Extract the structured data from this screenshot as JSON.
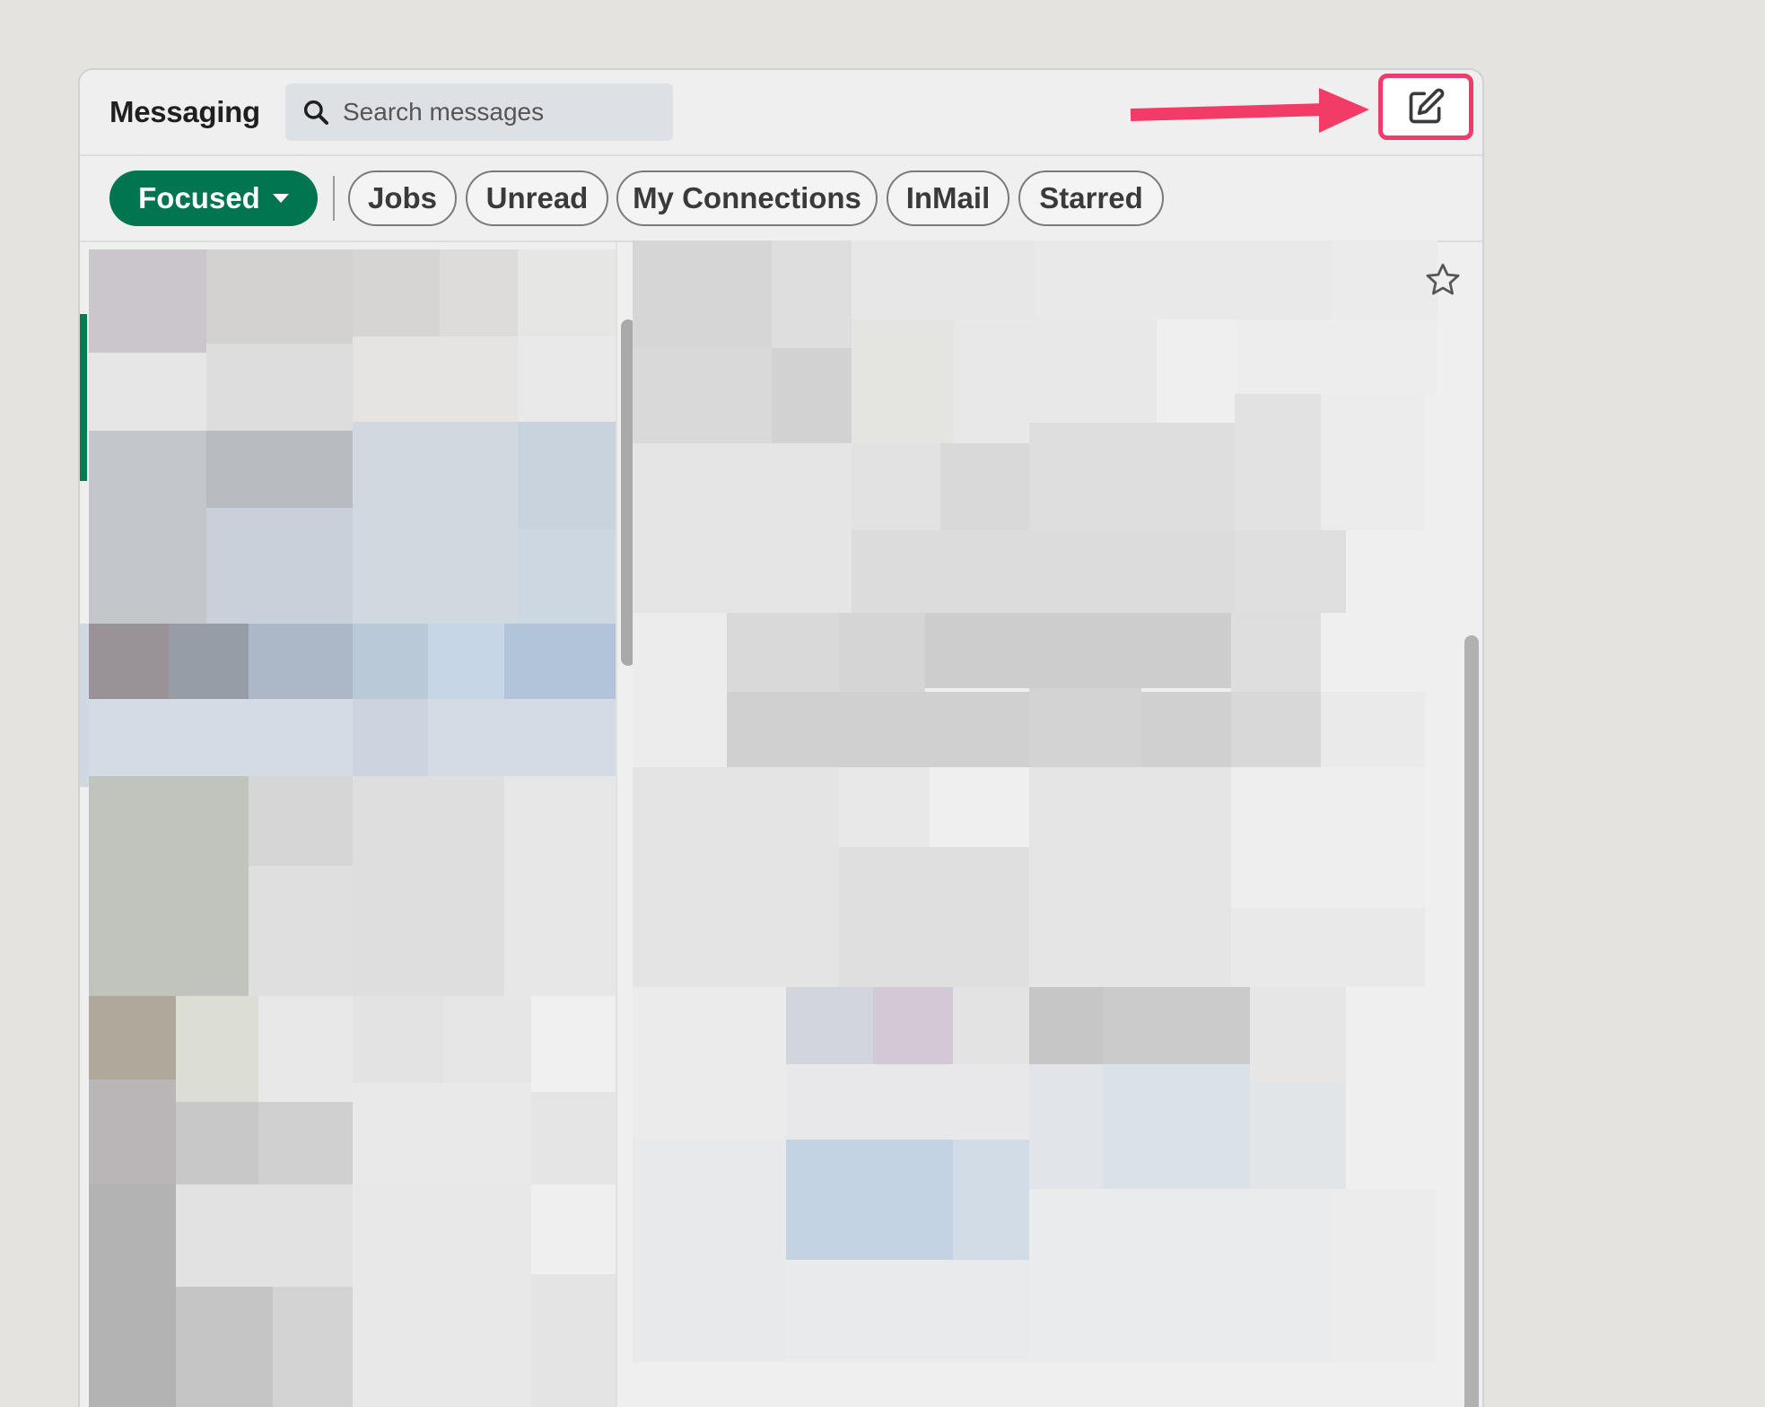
{
  "header": {
    "title": "Messaging",
    "search": {
      "placeholder": "Search messages",
      "icon": "search-icon"
    },
    "compose": {
      "icon": "compose-icon",
      "highlight_color": "#ef3c6a"
    }
  },
  "filters": {
    "active": {
      "label": "Focused",
      "icon": "caret-down-icon"
    },
    "pills": [
      "Jobs",
      "Unread",
      "My Connections",
      "InMail",
      "Starred"
    ]
  },
  "thread": {
    "star_icon": "star-icon"
  },
  "colors": {
    "accent": "#01754f",
    "annotation": "#ef3c6a"
  }
}
